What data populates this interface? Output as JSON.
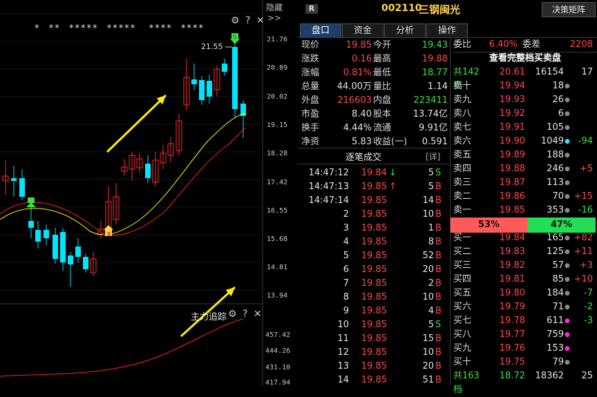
{
  "chart": {
    "star_marks": "*  **  *****  *****   ****  ****",
    "peak_label": "21.55",
    "y_ticks": [
      "21.76",
      "20.89",
      "20.02",
      "19.15",
      "18.28",
      "17.42",
      "16.55",
      "15.68",
      "14.81",
      "13.94"
    ],
    "indicator_label": "主力追踪",
    "indicator_ticks": [
      "457.42",
      "444.26",
      "431.10",
      "417.94"
    ],
    "hide_label": "隐藏",
    "badge_b": "B",
    "badge_s": "S"
  },
  "header": {
    "r_badge": "R",
    "code": "002110",
    "name": "三钢闽光",
    "btn": "决策矩阵"
  },
  "tabs": [
    "盘口",
    "资金",
    "分析",
    "操作"
  ],
  "quote": [
    {
      "l1": "现价",
      "v1": "19.85",
      "c1": "red",
      "l2": "今开",
      "v2": "19.43",
      "c2": "green"
    },
    {
      "l1": "涨跌",
      "v1": "0.16",
      "c1": "red",
      "l2": "最高",
      "v2": "19.88",
      "c2": "red"
    },
    {
      "l1": "涨幅",
      "v1": "0.81%",
      "c1": "red",
      "l2": "最低",
      "v2": "18.77",
      "c2": "green"
    },
    {
      "l1": "总量",
      "v1": "44.00万",
      "c1": "white",
      "l2": "量比",
      "v2": "1.14",
      "c2": "white"
    },
    {
      "l1": "外盘",
      "v1": "216603",
      "c1": "red",
      "l2": "内盘",
      "v2": "223411",
      "c2": "green"
    },
    {
      "l1": "市盈",
      "v1": "8.40",
      "c1": "white",
      "l2": "股本",
      "v2": "13.74亿",
      "c2": "white"
    },
    {
      "l1": "换手",
      "v1": "4.44%",
      "c1": "white",
      "l2": "流通",
      "v2": "9.91亿",
      "c2": "white"
    },
    {
      "l1": "净资",
      "v1": "5.83",
      "c1": "white",
      "l2": "收益(一)",
      "v2": "0.591",
      "c2": "white"
    }
  ],
  "ticks_title": "逐笔成交",
  "ticks_detail": "[详]",
  "ticks": [
    {
      "t": "14:47:12",
      "p": "19.84",
      "a": "down",
      "v": "5",
      "s": "S"
    },
    {
      "t": "14:47:13",
      "p": "19.85",
      "a": "up",
      "v": "5",
      "s": "B"
    },
    {
      "t": "14:47:14",
      "p": "19.85",
      "a": "",
      "v": "14",
      "s": "B"
    },
    {
      "t": "2",
      "p": "19.85",
      "a": "",
      "v": "10",
      "s": "B"
    },
    {
      "t": "3",
      "p": "19.85",
      "a": "",
      "v": "1",
      "s": "B"
    },
    {
      "t": "4",
      "p": "19.85",
      "a": "",
      "v": "8",
      "s": "B"
    },
    {
      "t": "5",
      "p": "19.85",
      "a": "",
      "v": "52",
      "s": "B"
    },
    {
      "t": "6",
      "p": "19.85",
      "a": "",
      "v": "20",
      "s": "B"
    },
    {
      "t": "7",
      "p": "19.85",
      "a": "",
      "v": "2",
      "s": "B"
    },
    {
      "t": "8",
      "p": "19.85",
      "a": "",
      "v": "10",
      "s": "B"
    },
    {
      "t": "9",
      "p": "19.85",
      "a": "",
      "v": "4",
      "s": "B"
    },
    {
      "t": "10",
      "p": "19.85",
      "a": "",
      "v": "5",
      "s": "S"
    },
    {
      "t": "11",
      "p": "19.85",
      "a": "",
      "v": "15",
      "s": "B"
    },
    {
      "t": "12",
      "p": "19.85",
      "a": "",
      "v": "10",
      "s": "B"
    },
    {
      "t": "13",
      "p": "19.85",
      "a": "",
      "v": "20",
      "s": "B"
    },
    {
      "t": "14",
      "p": "19.85",
      "a": "",
      "v": "51",
      "s": "B"
    }
  ],
  "book": {
    "weibi_label": "委比",
    "weibi": "6.40%",
    "weicha_label": "委差",
    "weicha": "2208",
    "title": "查看完整档买卖盘",
    "sell_total": {
      "label": "共142档",
      "p": "20.61",
      "v": "16154",
      "x": "17"
    },
    "sells": [
      {
        "l": "卖十",
        "p": "19.94",
        "v": "18",
        "dot": "gray",
        "d": ""
      },
      {
        "l": "卖九",
        "p": "19.93",
        "v": "26",
        "dot": "gray",
        "d": ""
      },
      {
        "l": "卖八",
        "p": "19.92",
        "v": "6",
        "dot": "gray",
        "d": ""
      },
      {
        "l": "卖七",
        "p": "19.91",
        "v": "105",
        "dot": "gray",
        "d": ""
      },
      {
        "l": "卖六",
        "p": "19.90",
        "v": "1049",
        "dot": "cyan",
        "d": "-94"
      },
      {
        "l": "卖五",
        "p": "19.89",
        "v": "188",
        "dot": "gray",
        "d": ""
      },
      {
        "l": "卖四",
        "p": "19.88",
        "v": "246",
        "dot": "gray",
        "d": "+5"
      },
      {
        "l": "卖三",
        "p": "19.87",
        "v": "113",
        "dot": "gray",
        "d": ""
      },
      {
        "l": "卖二",
        "p": "19.86",
        "v": "70",
        "dot": "gray",
        "d": "+15"
      },
      {
        "l": "卖一",
        "p": "19.85",
        "v": "353",
        "dot": "gray",
        "d": "-16"
      }
    ],
    "bar_left": "53%",
    "bar_left_frac": 0.53,
    "bar_right": "47%",
    "buys": [
      {
        "l": "买一",
        "p": "19.84",
        "v": "165",
        "dot": "gray",
        "d": "+82"
      },
      {
        "l": "买二",
        "p": "19.83",
        "v": "125",
        "dot": "gray",
        "d": "+11"
      },
      {
        "l": "买三",
        "p": "19.82",
        "v": "57",
        "dot": "gray",
        "d": "+3"
      },
      {
        "l": "买四",
        "p": "19.81",
        "v": "85",
        "dot": "gray",
        "d": "+10"
      },
      {
        "l": "买五",
        "p": "19.80",
        "v": "184",
        "dot": "gray",
        "d": "-7"
      },
      {
        "l": "买六",
        "p": "19.79",
        "v": "71",
        "dot": "gray",
        "d": "-2"
      },
      {
        "l": "买七",
        "p": "19.78",
        "v": "611",
        "dot": "magenta",
        "d": "-3"
      },
      {
        "l": "买八",
        "p": "19.77",
        "v": "759",
        "dot": "magenta",
        "d": ""
      },
      {
        "l": "买九",
        "p": "19.76",
        "v": "153",
        "dot": "magenta",
        "d": ""
      },
      {
        "l": "买十",
        "p": "19.75",
        "v": "79",
        "dot": "gray",
        "d": ""
      }
    ],
    "buy_total": {
      "label": "共163档",
      "p": "18.72",
      "v": "18362",
      "x": "25"
    }
  },
  "colors": {
    "up": "#ff2b2b",
    "down": "#00e5ff",
    "ma5": "#ffff00",
    "ma10": "#ff2020",
    "arrow": "#ffee00"
  }
}
